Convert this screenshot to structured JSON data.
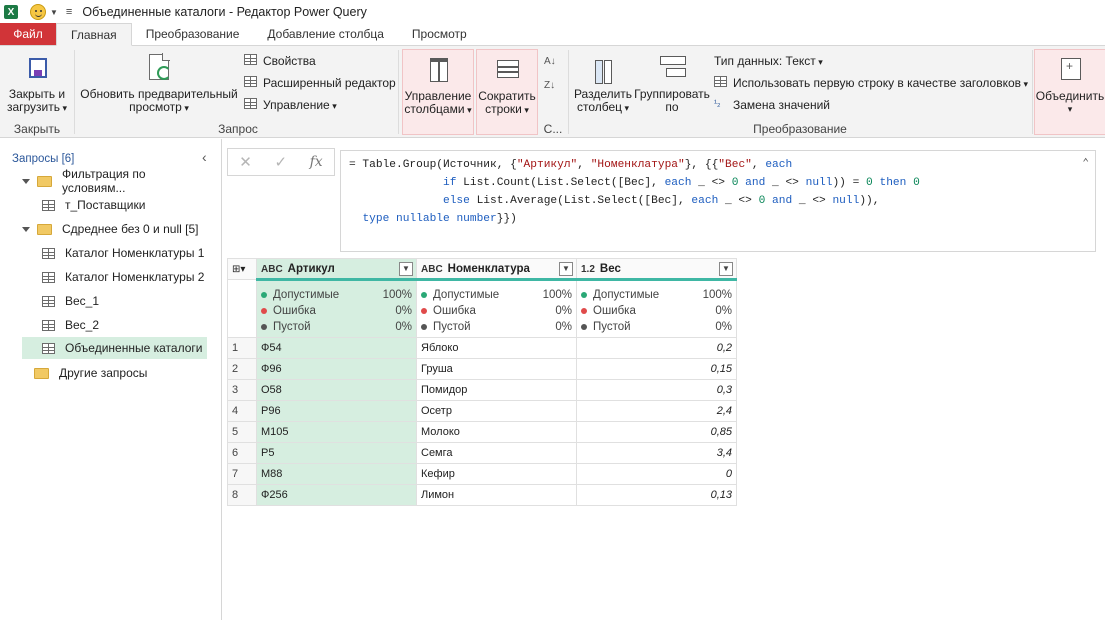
{
  "window": {
    "title": "Объединенные каталоги - Редактор Power Query",
    "app_logo_letter": "X"
  },
  "tabs": [
    {
      "label": "Файл"
    },
    {
      "label": "Главная"
    },
    {
      "label": "Преобразование"
    },
    {
      "label": "Добавление столбца"
    },
    {
      "label": "Просмотр"
    }
  ],
  "ribbon": {
    "close_load": {
      "line1": "Закрыть и",
      "line2": "загрузить"
    },
    "refresh_preview": {
      "line1": "Обновить предварительный",
      "line2": "просмотр"
    },
    "properties": "Свойства",
    "advanced_editor": "Расширенный редактор",
    "manage": "Управление",
    "manage_columns": {
      "line1": "Управление",
      "line2": "столбцами"
    },
    "reduce_rows": {
      "line1": "Сократить",
      "line2": "строки"
    },
    "sort_group_label": "С...",
    "split_column": {
      "line1": "Разделить",
      "line2": "столбец"
    },
    "group_by": {
      "line1": "Группировать",
      "line2": "по"
    },
    "data_type": "Тип данных: Текст",
    "first_row_header": "Использовать первую строку в качестве заголовков",
    "replace_values": "Замена значений",
    "combine": "Объединить",
    "groups": {
      "close": "Закрыть",
      "query": "Запрос",
      "transform": "Преобразование"
    }
  },
  "queries_pane": {
    "title": "Запросы [6]",
    "items": [
      {
        "label": "Фильтрация по условиям..."
      },
      {
        "label": "т_Поставщики"
      },
      {
        "label": "Сдреднее без 0 и null [5]"
      },
      {
        "label": "Каталог Номенклатуры 1"
      },
      {
        "label": "Каталог Номенклатуры 2"
      },
      {
        "label": "Вес_1"
      },
      {
        "label": "Вес_2"
      },
      {
        "label": "Объединенные каталоги"
      },
      {
        "label": "Другие запросы"
      }
    ]
  },
  "formula_bar": {
    "cancel_glyph": "✕",
    "confirm_glyph": "✓",
    "fx": "fx"
  },
  "grid": {
    "columns": [
      {
        "type": "ABC",
        "name": "Артикул"
      },
      {
        "type": "ABC",
        "name": "Номенклатура"
      },
      {
        "type": "1.2",
        "name": "Вес"
      }
    ],
    "quality_labels": {
      "valid": "Допустимые",
      "error": "Ошибка",
      "empty": "Пустой"
    },
    "quality": [
      {
        "valid": "100%",
        "error": "0%",
        "empty": "0%"
      },
      {
        "valid": "100%",
        "error": "0%",
        "empty": "0%"
      },
      {
        "valid": "100%",
        "error": "0%",
        "empty": "0%"
      }
    ],
    "rows": [
      {
        "n": "1",
        "art": "Ф54",
        "nom": "Яблоко",
        "w": "0,2"
      },
      {
        "n": "2",
        "art": "Ф96",
        "nom": "Груша",
        "w": "0,15"
      },
      {
        "n": "3",
        "art": "О58",
        "nom": "Помидор",
        "w": "0,3"
      },
      {
        "n": "4",
        "art": "Р96",
        "nom": "Осетр",
        "w": "2,4"
      },
      {
        "n": "5",
        "art": "М105",
        "nom": "Молоко",
        "w": "0,85"
      },
      {
        "n": "6",
        "art": "Р5",
        "nom": "Семга",
        "w": "3,4"
      },
      {
        "n": "7",
        "art": "М88",
        "nom": "Кефир",
        "w": "0"
      },
      {
        "n": "8",
        "art": "Ф256",
        "nom": "Лимон",
        "w": "0,13"
      }
    ]
  },
  "colors": {
    "file_tab": "#d13438",
    "selection": "#d6eee0",
    "quality_bar": "#3fb7a4",
    "valid_dot": "#2aa876",
    "error_dot": "#e04a4a",
    "empty_dot": "#555555"
  }
}
